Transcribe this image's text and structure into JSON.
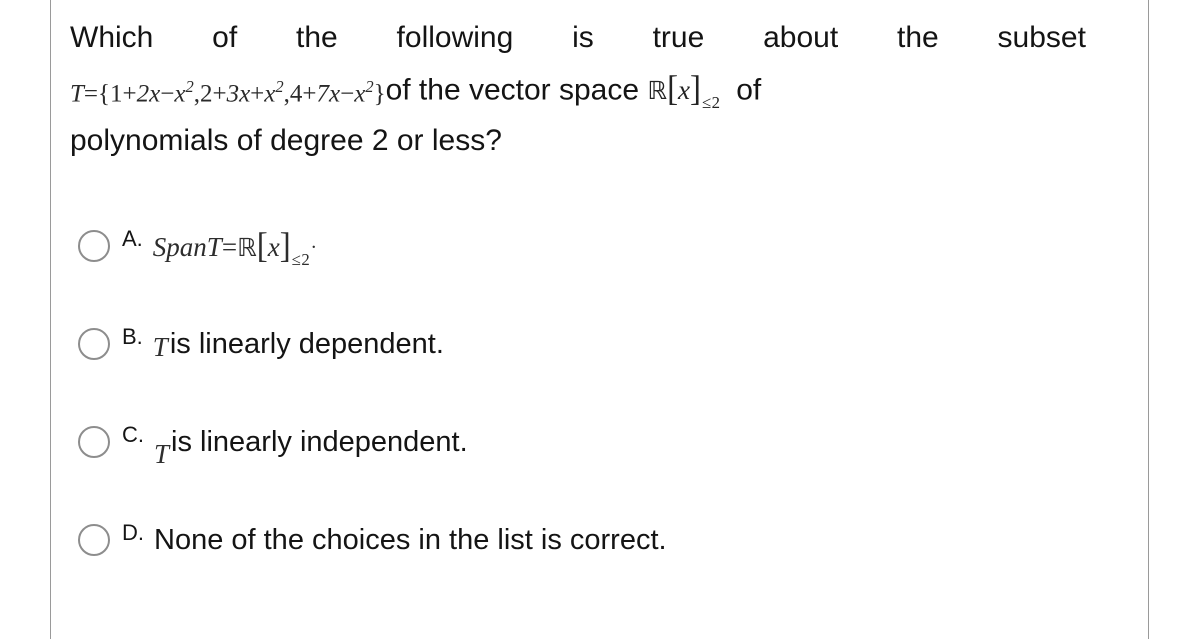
{
  "question": {
    "line1_words": [
      "Which",
      "of",
      "the",
      "following",
      "is",
      "true",
      "about",
      "the",
      "subset"
    ],
    "set_label": "T",
    "set_equals": "=",
    "set_open": "{",
    "set_terms": [
      {
        "const": "1",
        "op1": "+",
        "lin": "2x",
        "op2": "−",
        "quad": "x",
        "exp": "2"
      },
      {
        "const": "2",
        "op1": "+",
        "lin": "3x",
        "op2": "+",
        "quad": "x",
        "exp": "2"
      },
      {
        "const": "4",
        "op1": "+",
        "lin": "7x",
        "op2": "−",
        "quad": "x",
        "exp": "2"
      }
    ],
    "set_comma": ",",
    "set_close": "}",
    "mid_text": "of the vector space",
    "space_R": "ℝ",
    "space_open": "[",
    "space_var": "x",
    "space_close": "]",
    "space_sub": "≤2",
    "tail_text": "of",
    "line3": "polynomials of degree 2 or less?"
  },
  "options": [
    {
      "letter": "A.",
      "kind": "math",
      "span_text": "SpanT",
      "equals": "=",
      "space_R": "ℝ",
      "space_open": "[",
      "space_var": "x",
      "space_close": "]",
      "space_sub": "≤2",
      "period": "."
    },
    {
      "letter": "B.",
      "kind": "mixed",
      "var": "T",
      "text": "is linearly dependent.",
      "var_drop": "mid"
    },
    {
      "letter": "C.",
      "kind": "mixed",
      "var": "T",
      "text": "is linearly independent.",
      "var_drop": "low"
    },
    {
      "letter": "D.",
      "kind": "plain",
      "text": "None of the choices in the list is correct."
    }
  ],
  "colors": {
    "rule": "#9a9a9a",
    "radio_border": "#8d8d8d",
    "text": "#141414",
    "background": "#ffffff"
  }
}
